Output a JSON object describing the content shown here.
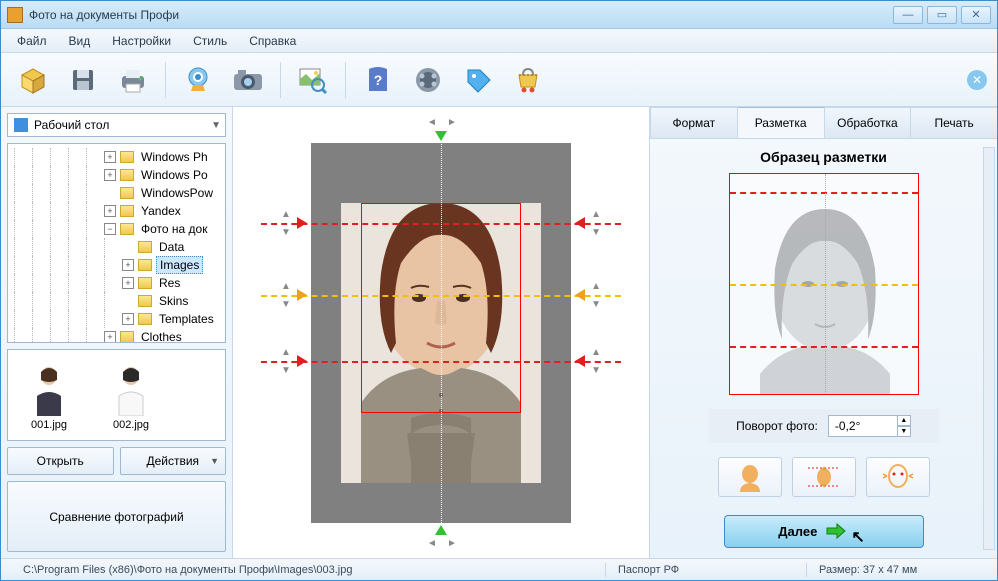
{
  "window": {
    "title": "Фото на документы Профи"
  },
  "menu": {
    "file": "Файл",
    "view": "Вид",
    "settings": "Настройки",
    "style": "Стиль",
    "help": "Справка"
  },
  "sidebar": {
    "combo": "Рабочий стол",
    "tree": [
      {
        "label": "Windows Ph",
        "indent": 5,
        "toggle": "+"
      },
      {
        "label": "Windows Po",
        "indent": 5,
        "toggle": "+"
      },
      {
        "label": "WindowsPow",
        "indent": 5,
        "toggle": ""
      },
      {
        "label": "Yandex",
        "indent": 5,
        "toggle": "+"
      },
      {
        "label": "Фото на док",
        "indent": 5,
        "toggle": "−"
      },
      {
        "label": "Data",
        "indent": 6,
        "toggle": ""
      },
      {
        "label": "Images",
        "indent": 6,
        "toggle": "+",
        "selected": true
      },
      {
        "label": "Res",
        "indent": 6,
        "toggle": "+"
      },
      {
        "label": "Skins",
        "indent": 6,
        "toggle": ""
      },
      {
        "label": "Templates",
        "indent": 6,
        "toggle": "+"
      },
      {
        "label": "Clothes",
        "indent": 5,
        "toggle": "+"
      }
    ],
    "thumbs": [
      {
        "name": "001.jpg"
      },
      {
        "name": "002.jpg"
      }
    ],
    "open_btn": "Открыть",
    "actions_btn": "Действия",
    "compare_btn": "Сравнение фотографий"
  },
  "tabs": {
    "format": "Формат",
    "markup": "Разметка",
    "processing": "Обработка",
    "print": "Печать"
  },
  "right": {
    "sample_title": "Образец разметки",
    "rotate_label": "Поворот фото:",
    "rotate_value": "-0,2°",
    "next": "Далее"
  },
  "status": {
    "path": "C:\\Program Files (x86)\\Фото на документы Профи\\Images\\003.jpg",
    "passport": "Паспорт РФ",
    "size": "Размер: 37 x 47 мм"
  }
}
